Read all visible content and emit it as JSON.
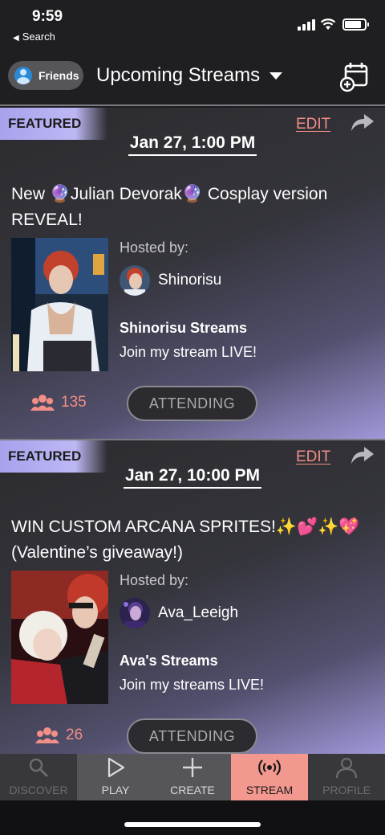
{
  "status_bar": {
    "time": "9:59",
    "back_label": "Search"
  },
  "header": {
    "friends_label": "Friends",
    "title": "Upcoming Streams"
  },
  "streams": [
    {
      "badge": "FEATURED",
      "edit_label": "EDIT",
      "date": "Jan 27, 1:00 PM",
      "title": "New 🔮Julian Devorak🔮 Cosplay version REVEAL!",
      "hosted_by_label": "Hosted by:",
      "host_name": "Shinorisu",
      "stream_name": "Shinorisu Streams",
      "stream_description": "Join my stream LIVE!",
      "attendee_count": "135",
      "attend_button": "ATTENDING"
    },
    {
      "badge": "FEATURED",
      "edit_label": "EDIT",
      "date": "Jan 27, 10:00 PM",
      "title": "WIN CUSTOM ARCANA SPRITES!✨💕✨💖 (Valentine’s giveaway!)",
      "hosted_by_label": "Hosted by:",
      "host_name": "Ava_Leeigh",
      "stream_name": "Ava's Streams",
      "stream_description": "Join my streams LIVE!",
      "attendee_count": "26",
      "attend_button": "ATTENDING"
    }
  ],
  "tabs": [
    {
      "label": "DISCOVER",
      "icon": "search-icon"
    },
    {
      "label": "PLAY",
      "icon": "play-icon"
    },
    {
      "label": "CREATE",
      "icon": "plus-icon"
    },
    {
      "label": "STREAM",
      "icon": "broadcast-icon",
      "active": true
    },
    {
      "label": "PROFILE",
      "icon": "person-icon"
    }
  ],
  "colors": {
    "accent": "#f28f86",
    "featured": "#a7a2ec",
    "background": "#1f1f22"
  }
}
